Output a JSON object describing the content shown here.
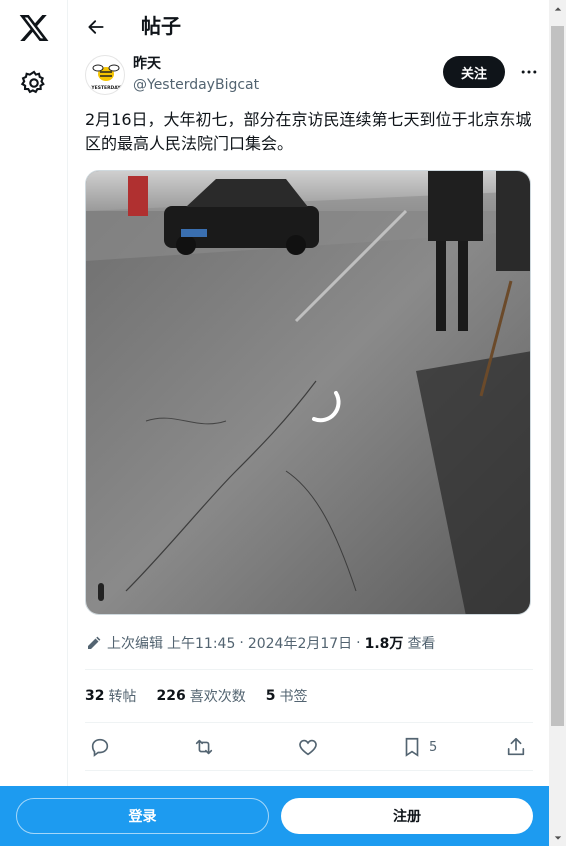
{
  "header": {
    "title": "帖子",
    "back_icon": "arrow-left-icon"
  },
  "sidebar": {
    "logo_icon": "x-logo-icon",
    "settings_icon": "gear-icon"
  },
  "post": {
    "author_name": "昨天",
    "author_handle": "@YesterdayBigcat",
    "avatar_text": "YESTERDAY",
    "follow_label": "关注",
    "text": "2月16日，大年初七，部分在京访民连续第七天到位于北京东城区的最高人民法院门口集会。",
    "media_description_icon": "loading-spinner-icon",
    "meta": {
      "edited_label": "上次编辑",
      "time": "上午11:45",
      "sep1": "·",
      "date": "2024年2月17日",
      "sep2": "·",
      "views_count": "1.8万",
      "views_label": "查看"
    },
    "stats": {
      "reposts_count": "32",
      "reposts_label": "转帖",
      "likes_count": "226",
      "likes_label": "喜欢次数",
      "bookmarks_count": "5",
      "bookmarks_label": "书签"
    },
    "actions": {
      "reply_icon": "reply-icon",
      "repost_icon": "repost-icon",
      "like_icon": "heart-icon",
      "bookmark_icon": "bookmark-icon",
      "bookmark_count": "5",
      "share_icon": "share-icon"
    }
  },
  "bottom_bar": {
    "login_label": "登录",
    "signup_label": "注册"
  },
  "colors": {
    "accent": "#1d9bf0",
    "text": "#0f1419",
    "secondary": "#536471"
  }
}
